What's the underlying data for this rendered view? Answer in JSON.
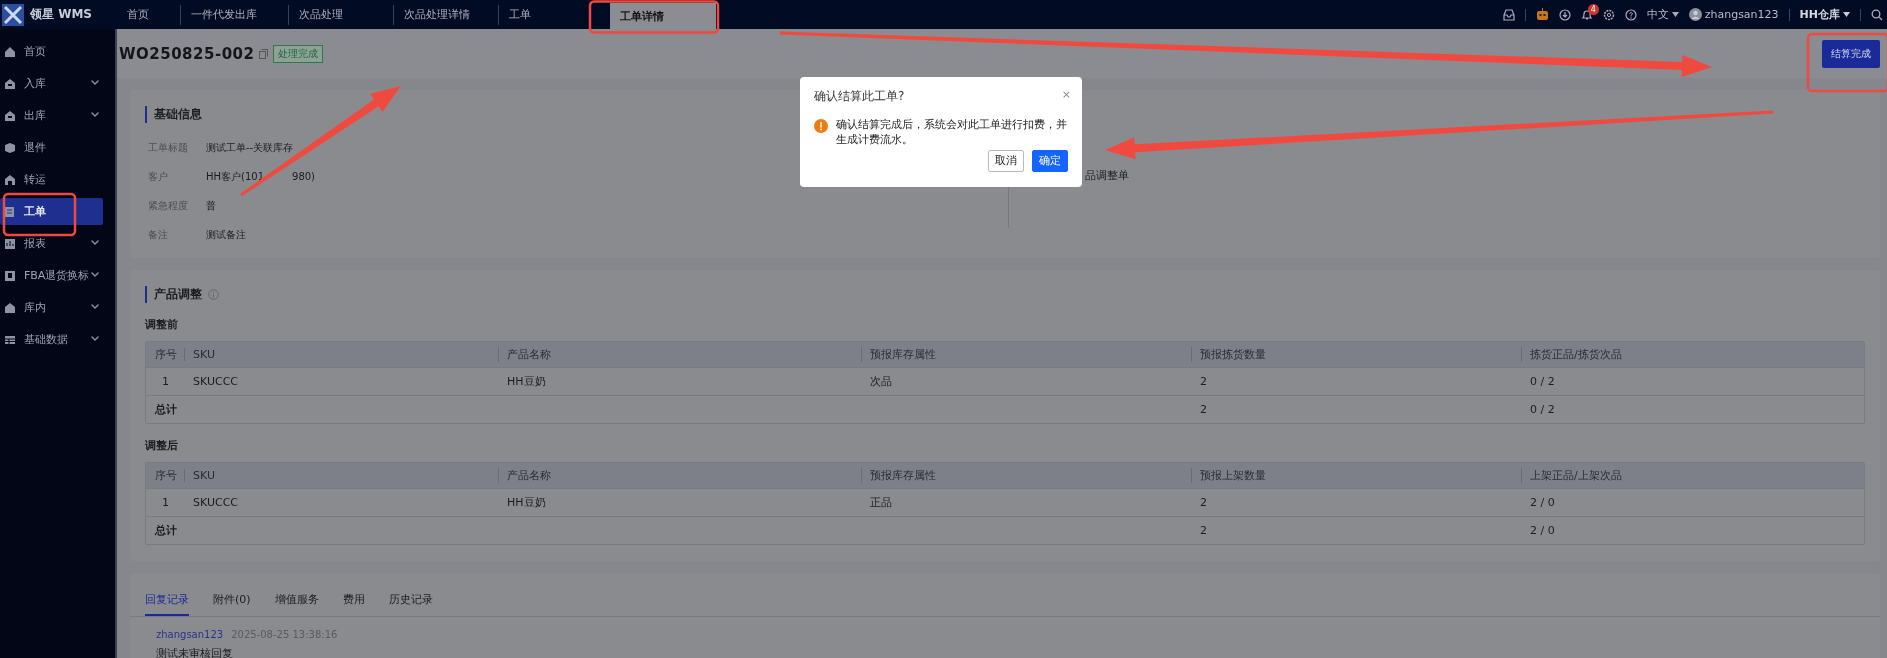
{
  "app": {
    "name": "领星 WMS"
  },
  "top_tabs": [
    {
      "label": "首页",
      "selected": false
    },
    {
      "label": "一件代发出库",
      "selected": false
    },
    {
      "label": "次品处理",
      "selected": false
    },
    {
      "label": "次品处理详情",
      "selected": false
    },
    {
      "label": "工单",
      "selected": false
    },
    {
      "label": "工单详情",
      "selected": true
    }
  ],
  "top_bar": {
    "notification_count": "4",
    "language": "中文",
    "user": "zhangsan123",
    "warehouse": "HH仓库"
  },
  "sidebar": {
    "items": [
      {
        "label": "首页",
        "selected": false,
        "expandable": false
      },
      {
        "label": "入库",
        "selected": false,
        "expandable": true
      },
      {
        "label": "出库",
        "selected": false,
        "expandable": true
      },
      {
        "label": "退件",
        "selected": false,
        "expandable": false
      },
      {
        "label": "转运",
        "selected": false,
        "expandable": false
      },
      {
        "label": "工单",
        "selected": true,
        "expandable": false
      },
      {
        "label": "报表",
        "selected": false,
        "expandable": true
      },
      {
        "label": "FBA退货换标",
        "selected": false,
        "expandable": true
      },
      {
        "label": "库内",
        "selected": false,
        "expandable": true
      },
      {
        "label": "基础数据",
        "selected": false,
        "expandable": true
      }
    ]
  },
  "page": {
    "order_no": "WO250825-002",
    "status": "处理完成",
    "primary_action": "结算完成"
  },
  "basic_info": {
    "title": "基础信息",
    "fields": [
      {
        "label": "工单标题",
        "value": "测试工单--关联库存"
      },
      {
        "label": "客户",
        "value": "HH客户(101",
        "value_tail": "980)"
      },
      {
        "label": "紧急程度",
        "value": "普"
      },
      {
        "label": "备注",
        "value": "测试备注"
      }
    ],
    "side_text": "品调整单"
  },
  "product_adjust": {
    "title": "产品调整",
    "tables": [
      {
        "title": "调整前",
        "columns": [
          "序号",
          "SKU",
          "产品名称",
          "预报库存属性",
          "预报拣货数量",
          "拣货正品/拣货次品"
        ],
        "rows": [
          [
            "1",
            "SKUCCC",
            "HH豆奶",
            "次品",
            "2",
            "0 / 2"
          ]
        ],
        "total": {
          "label": "总计",
          "qty": "2",
          "split": "0 / 2"
        }
      },
      {
        "title": "调整后",
        "columns": [
          "序号",
          "SKU",
          "产品名称",
          "预报库存属性",
          "预报上架数量",
          "上架正品/上架次品"
        ],
        "rows": [
          [
            "1",
            "SKUCCC",
            "HH豆奶",
            "正品",
            "2",
            "2 / 0"
          ]
        ],
        "total": {
          "label": "总计",
          "qty": "2",
          "split": "2 / 0"
        }
      }
    ]
  },
  "bottom_tabs": [
    {
      "label": "回复记录",
      "selected": true
    },
    {
      "label": "附件(0)",
      "selected": false
    },
    {
      "label": "增值服务",
      "selected": false
    },
    {
      "label": "费用",
      "selected": false
    },
    {
      "label": "历史记录",
      "selected": false
    }
  ],
  "reply": {
    "user": "zhangsan123",
    "time": "2025-08-25 13:38:16",
    "text": "测试未审核回复"
  },
  "dialog": {
    "title": "确认结算此工单?",
    "close": "×",
    "message": "确认结算完成后，系统会对此工单进行扣费，并生成计费流水。",
    "buttons": [
      {
        "label": "取消",
        "kind": "secondary"
      },
      {
        "label": "确定",
        "kind": "primary"
      }
    ]
  }
}
